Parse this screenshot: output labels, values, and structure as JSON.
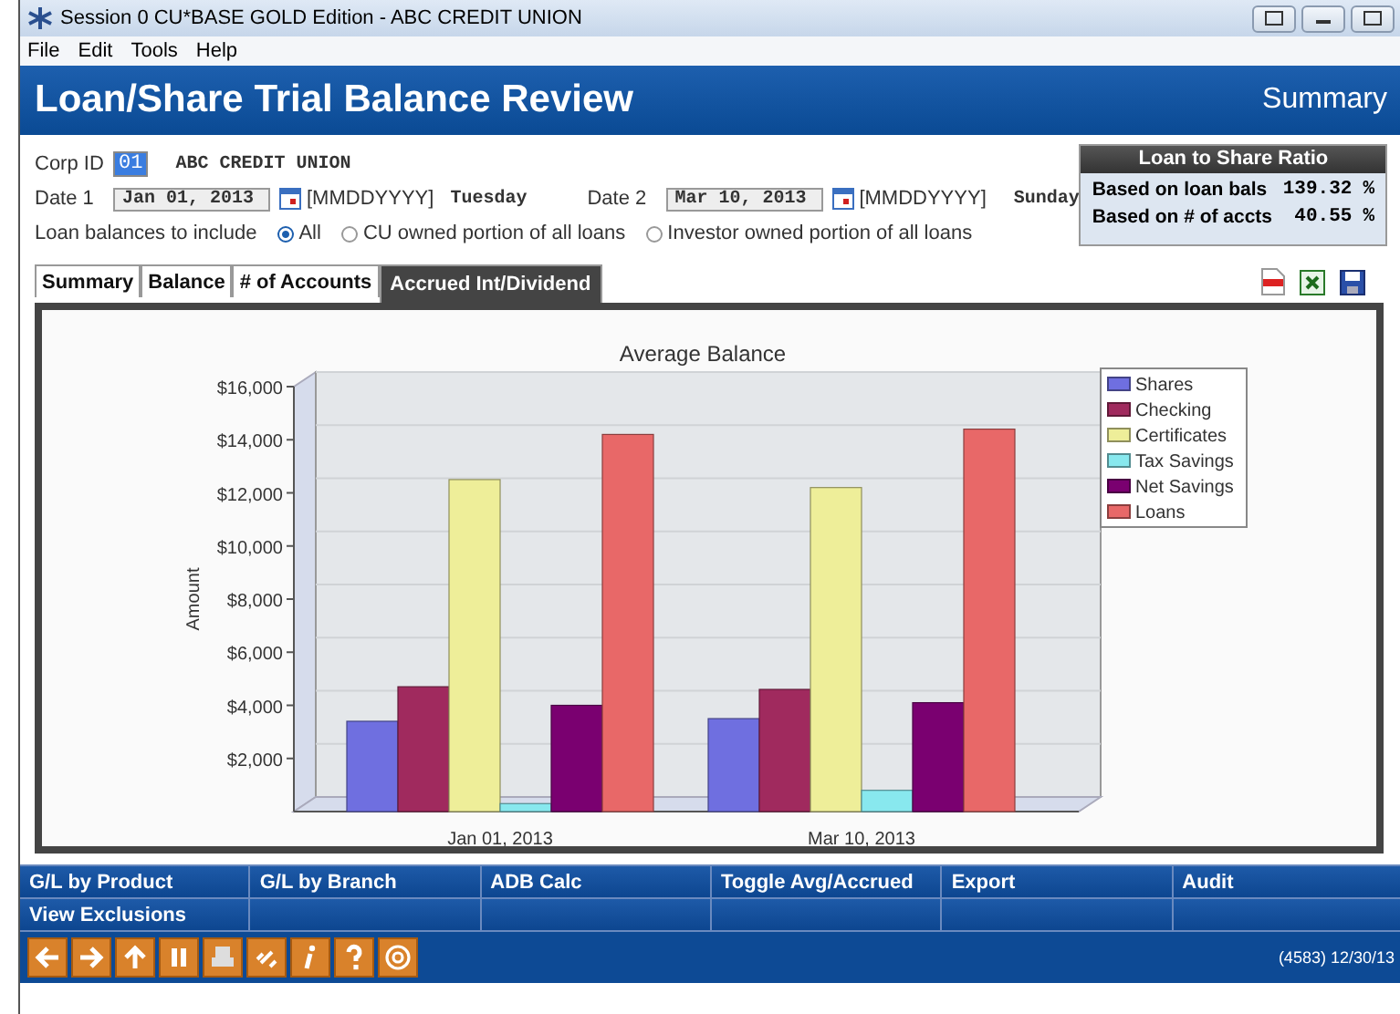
{
  "window": {
    "title": "Session 0 CU*BASE GOLD Edition - ABC CREDIT UNION"
  },
  "menu": [
    "File",
    "Edit",
    "Tools",
    "Help"
  ],
  "header": {
    "title": "Loan/Share Trial Balance Review",
    "mode": "Summary"
  },
  "form": {
    "corp_id_label": "Corp ID",
    "corp_id": "01",
    "corp_name": "ABC CREDIT UNION",
    "date1_label": "Date 1",
    "date1": "Jan 01, 2013",
    "date1_format": "[MMDDYYYY]",
    "date1_day": "Tuesday",
    "date2_label": "Date 2",
    "date2": "Mar 10, 2013",
    "date2_format": "[MMDDYYYY]",
    "date2_day": "Sunday",
    "include_label": "Loan balances to include",
    "include_options": [
      {
        "label": "All",
        "selected": true
      },
      {
        "label": "CU owned portion of all loans",
        "selected": false
      },
      {
        "label": "Investor owned portion of all loans",
        "selected": false
      }
    ]
  },
  "ratio": {
    "title": "Loan to Share Ratio",
    "rows": [
      {
        "label": "Based on loan bals",
        "value": "139.32",
        "unit": "%"
      },
      {
        "label": "Based on # of accts",
        "value": "40.55",
        "unit": "%"
      }
    ]
  },
  "tabs": [
    {
      "label": "Summary",
      "selected": false
    },
    {
      "label": "Balance",
      "selected": false
    },
    {
      "label": "# of Accounts",
      "selected": false
    },
    {
      "label": "Accrued Int/Dividend",
      "selected": true
    }
  ],
  "chart_data": {
    "type": "bar",
    "title": "Average Balance",
    "ylabel": "Amount",
    "categories": [
      "Jan 01, 2013",
      "Mar 10, 2013"
    ],
    "series": [
      {
        "name": "Shares",
        "color": "#6f6fe0",
        "values": [
          3400,
          3500
        ]
      },
      {
        "name": "Checking",
        "color": "#a02a5e",
        "values": [
          4700,
          4600
        ]
      },
      {
        "name": "Certificates",
        "color": "#eeee99",
        "values": [
          12500,
          12200
        ]
      },
      {
        "name": "Tax Savings",
        "color": "#88e8ee",
        "values": [
          300,
          800
        ]
      },
      {
        "name": "Net Savings",
        "color": "#7a0070",
        "values": [
          4000,
          4100
        ]
      },
      {
        "name": "Loans",
        "color": "#e86868",
        "values": [
          14200,
          14400
        ]
      }
    ],
    "ylim": [
      0,
      16000
    ],
    "legend": true,
    "yticks": [
      {
        "value": 2000,
        "label": "$2,000"
      },
      {
        "value": 4000,
        "label": "$4,000"
      },
      {
        "value": 6000,
        "label": "$6,000"
      },
      {
        "value": 8000,
        "label": "$8,000"
      },
      {
        "value": 10000,
        "label": "$10,000"
      },
      {
        "value": 12000,
        "label": "$12,000"
      },
      {
        "value": 14000,
        "label": "$14,000"
      },
      {
        "value": 16000,
        "label": "$16,000"
      }
    ]
  },
  "action_buttons": [
    [
      "G/L by Product",
      "G/L by Branch",
      "ADB Calc",
      "Toggle Avg/Accrued",
      "Export",
      "Audit"
    ],
    [
      "View Exclusions"
    ]
  ],
  "status_bar": {
    "text": "(4583) 12/30/13"
  }
}
